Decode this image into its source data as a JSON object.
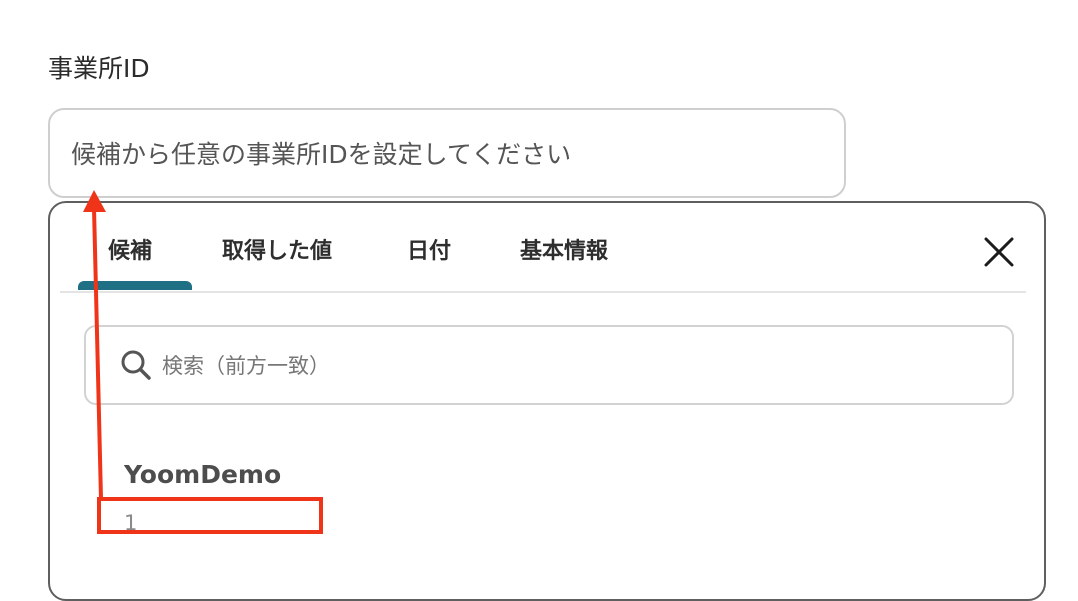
{
  "field": {
    "label": "事業所ID",
    "placeholder": "候補から任意の事業所IDを設定してください"
  },
  "dropdown": {
    "tabs": [
      {
        "label": "候補",
        "active": true
      },
      {
        "label": "取得した値",
        "active": false
      },
      {
        "label": "日付",
        "active": false
      },
      {
        "label": "基本情報",
        "active": false
      }
    ],
    "search_placeholder": "検索（前方一致）",
    "items": [
      {
        "title": "YoomDemo",
        "id": "1"
      }
    ]
  },
  "colors": {
    "active_tab_underline": "#1f6f85",
    "annotation": "#f0341a"
  },
  "icons": {
    "close": "close-icon",
    "search": "search-icon"
  }
}
